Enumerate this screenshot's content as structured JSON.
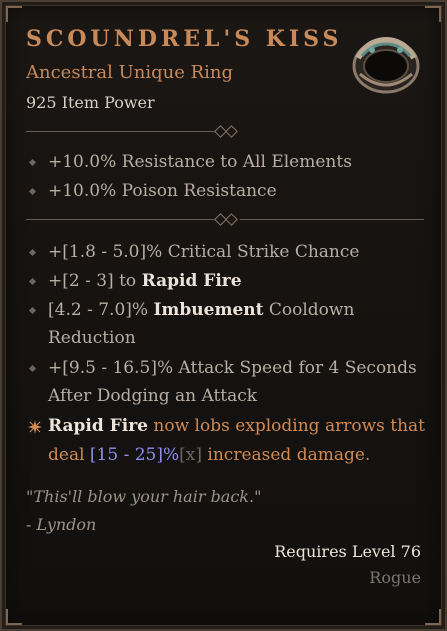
{
  "item": {
    "name": "SCOUNDREL'S KISS",
    "type": "Ancestral Unique Ring",
    "power": "925 Item Power",
    "icon": "ring-icon"
  },
  "implicits": [
    "+10.0% Resistance to All Elements",
    "+10.0% Poison Resistance"
  ],
  "affixes": {
    "crit": "+[1.8 - 5.0]% Critical Strike Chance",
    "rapid_prefix": "+[2 - 3] to ",
    "rapid_skill": "Rapid Fire",
    "imbue_prefix": "[4.2 - 7.0]% ",
    "imbue_word": "Imbuement",
    "imbue_suffix": " Cooldown",
    "imbue_line2": "Reduction",
    "attack_line1": "+[9.5 - 16.5]% Attack Speed for 4 Seconds",
    "attack_line2": "After Dodging an Attack"
  },
  "unique_power": {
    "skill": "Rapid Fire",
    "line1_rest": " now lobs exploding arrows that",
    "line2_prefix": "deal ",
    "range": "[15 - 25]%",
    "mult": "[x]",
    "line2_rest": " increased damage."
  },
  "flavor": {
    "quote": "\"This'll blow your hair back.\"",
    "author": "- Lyndon"
  },
  "requirements": {
    "level": "Requires Level 76",
    "class": "Rogue"
  },
  "colors": {
    "title": "#c98a5a",
    "unique_text": "#d38a52",
    "range": "#8e8ff0"
  }
}
